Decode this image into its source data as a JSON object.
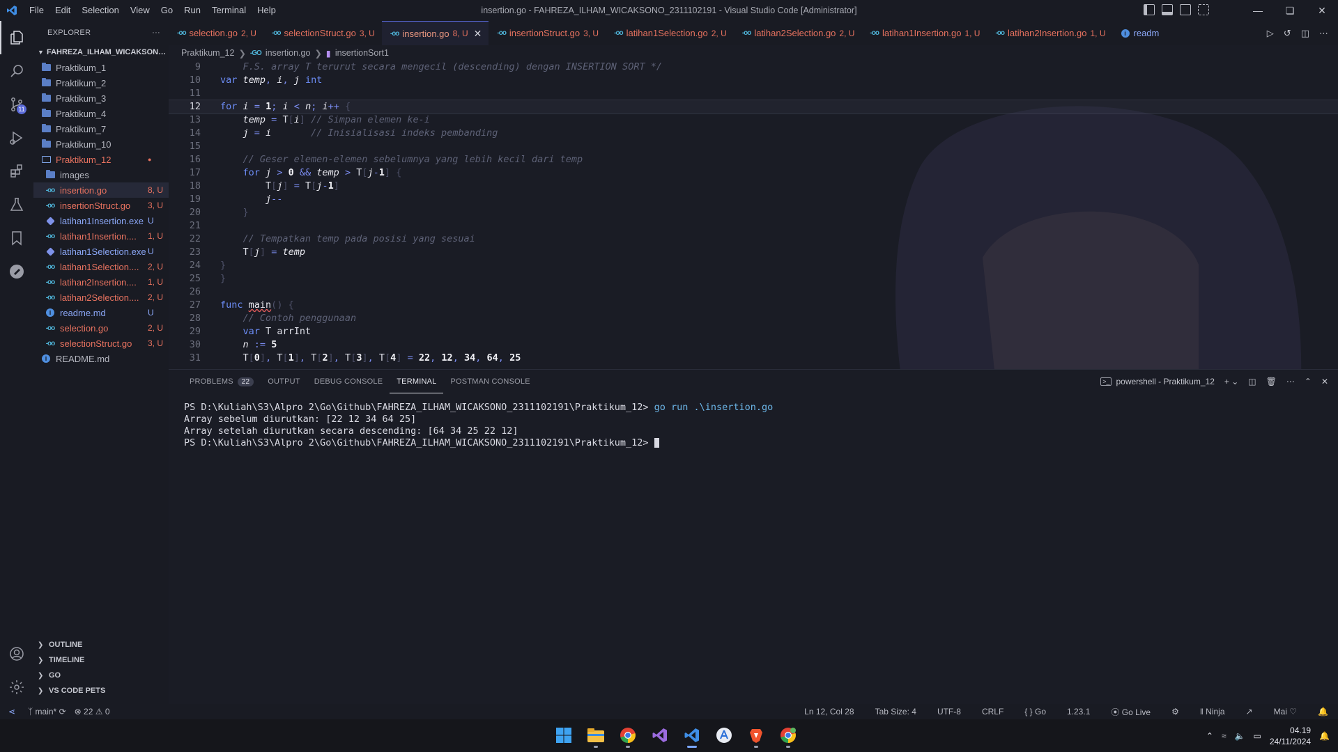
{
  "window": {
    "title": "insertion.go - FAHREZA_ILHAM_WICAKSONO_2311102191 - Visual Studio Code [Administrator]",
    "menu": [
      "File",
      "Edit",
      "Selection",
      "View",
      "Go",
      "Run",
      "Terminal",
      "Help"
    ]
  },
  "activity_bar": {
    "items": [
      "files-icon",
      "search-icon",
      "source-control-icon",
      "run-debug-icon",
      "extensions-icon",
      "testing-icon",
      "bookmarks-icon",
      "postman-icon"
    ],
    "scm_badge": "11",
    "bottom": [
      "accounts-icon",
      "settings-gear-icon"
    ]
  },
  "explorer": {
    "header": "EXPLORER",
    "more": "···",
    "workspace": "FAHREZA_ILHAM_WICAKSONO_2311102191",
    "tree": [
      {
        "label": "Praktikum_1",
        "status": "",
        "kind": "folder"
      },
      {
        "label": "Praktikum_2",
        "status": "",
        "kind": "folder"
      },
      {
        "label": "Praktikum_3",
        "status": "",
        "kind": "folder"
      },
      {
        "label": "Praktikum_4",
        "status": "",
        "kind": "folder"
      },
      {
        "label": "Praktikum_7",
        "status": "",
        "kind": "folder"
      },
      {
        "label": "Praktikum_10",
        "status": "",
        "kind": "folder"
      },
      {
        "label": "Praktikum_12",
        "status": "●",
        "kind": "folder-open"
      },
      {
        "label": "images",
        "status": "",
        "kind": "folder"
      },
      {
        "label": "insertion.go",
        "status": "8, U",
        "kind": "go"
      },
      {
        "label": "insertionStruct.go",
        "status": "3, U",
        "kind": "go"
      },
      {
        "label": "latihan1Insertion.exe",
        "status": "U",
        "kind": "exe"
      },
      {
        "label": "latihan1Insertion....",
        "status": "1, U",
        "kind": "go"
      },
      {
        "label": "latihan1Selection.exe",
        "status": "U",
        "kind": "exe"
      },
      {
        "label": "latihan1Selection....",
        "status": "2, U",
        "kind": "go"
      },
      {
        "label": "latihan2Insertion....",
        "status": "1, U",
        "kind": "go"
      },
      {
        "label": "latihan2Selection....",
        "status": "2, U",
        "kind": "go"
      },
      {
        "label": "readme.md",
        "status": "U",
        "kind": "info"
      },
      {
        "label": "selection.go",
        "status": "2, U",
        "kind": "go"
      },
      {
        "label": "selectionStruct.go",
        "status": "3, U",
        "kind": "go"
      },
      {
        "label": "README.md",
        "status": "",
        "kind": "info"
      }
    ],
    "sections": [
      "OUTLINE",
      "TIMELINE",
      "GO",
      "VS CODE PETS"
    ]
  },
  "tabs": [
    {
      "label": "selection.go",
      "status": "2, U"
    },
    {
      "label": "selectionStruct.go",
      "status": "3, U"
    },
    {
      "label": "insertion.go",
      "status": "8, U",
      "active": true
    },
    {
      "label": "insertionStruct.go",
      "status": "3, U"
    },
    {
      "label": "latihan1Selection.go",
      "status": "2, U"
    },
    {
      "label": "latihan2Selection.go",
      "status": "2, U"
    },
    {
      "label": "latihan1Insertion.go",
      "status": "1, U"
    },
    {
      "label": "latihan2Insertion.go",
      "status": "1, U"
    },
    {
      "label": "readm",
      "status": ""
    }
  ],
  "breadcrumbs": [
    "Praktikum_12",
    "insertion.go",
    "insertionSort1"
  ],
  "code": {
    "current_line": 12,
    "lines": [
      {
        "n": "9",
        "text": "    F.S. array T terurut secara mengecil (descending) dengan INSERTION SORT */"
      },
      {
        "n": "10",
        "text": "var temp, i, j int"
      },
      {
        "n": "11",
        "text": ""
      },
      {
        "n": "12",
        "text": "for i = 1; i < n; i++ {"
      },
      {
        "n": "13",
        "text": "    temp = T[i] // Simpan elemen ke-i"
      },
      {
        "n": "14",
        "text": "    j = i       // Inisialisasi indeks pembanding"
      },
      {
        "n": "15",
        "text": ""
      },
      {
        "n": "16",
        "text": "    // Geser elemen-elemen sebelumnya yang lebih kecil dari temp"
      },
      {
        "n": "17",
        "text": "    for j > 0 && temp > T[j-1] {"
      },
      {
        "n": "18",
        "text": "        T[j] = T[j-1]"
      },
      {
        "n": "19",
        "text": "        j--"
      },
      {
        "n": "20",
        "text": "    }"
      },
      {
        "n": "21",
        "text": ""
      },
      {
        "n": "22",
        "text": "    // Tempatkan temp pada posisi yang sesuai"
      },
      {
        "n": "23",
        "text": "    T[j] = temp"
      },
      {
        "n": "24",
        "text": "}"
      },
      {
        "n": "25",
        "text": "}"
      },
      {
        "n": "26",
        "text": ""
      },
      {
        "n": "27",
        "text": "func main() {"
      },
      {
        "n": "28",
        "text": "    // Contoh penggunaan"
      },
      {
        "n": "29",
        "text": "    var T arrInt"
      },
      {
        "n": "30",
        "text": "    n := 5"
      },
      {
        "n": "31",
        "text": "    T[0], T[1], T[2], T[3], T[4] = 22, 12, 34, 64, 25"
      }
    ]
  },
  "panel": {
    "tabs": [
      {
        "label": "PROBLEMS",
        "count": "22"
      },
      {
        "label": "OUTPUT",
        "count": ""
      },
      {
        "label": "DEBUG CONSOLE",
        "count": ""
      },
      {
        "label": "TERMINAL",
        "count": "",
        "active": true
      },
      {
        "label": "POSTMAN CONSOLE",
        "count": ""
      }
    ],
    "terminal_name": "powershell - Praktikum_12",
    "terminal": {
      "prompt": "PS D:\\Kuliah\\S3\\Alpro 2\\Go\\Github\\FAHREZA_ILHAM_WICAKSONO_2311102191\\Praktikum_12> ",
      "command": "go run .\\insertion.go",
      "output": [
        "Array sebelum diurutkan: [22 12 34 64 25]",
        "Array setelah diurutkan secara descending: [64 34 25 22 12]"
      ]
    }
  },
  "statusbar": {
    "branch": "main*",
    "errors": "22",
    "warnings": "0",
    "position": "Ln 12, Col 28",
    "tab_size": "Tab Size: 4",
    "encoding": "UTF-8",
    "eol": "CRLF",
    "language": "Go",
    "go_version": "1.23.1",
    "go_live": "Go Live",
    "ninja": "Ninja",
    "user": "Mai"
  },
  "taskbar": {
    "apps": [
      "windows-start-icon",
      "file-explorer-icon",
      "chrome-icon",
      "visual-studio-icon",
      "vscode-icon",
      "app-store-icon",
      "brave-icon",
      "chrome-profile-icon"
    ],
    "time": "04.19",
    "date": "24/11/2024"
  },
  "colors": {
    "accent": "#5b6be0",
    "background": "#1a1c25",
    "keyword": "#6c8cf5",
    "untracked": "#73c991",
    "error": "#e7725f",
    "modified": "#e2c08d"
  }
}
